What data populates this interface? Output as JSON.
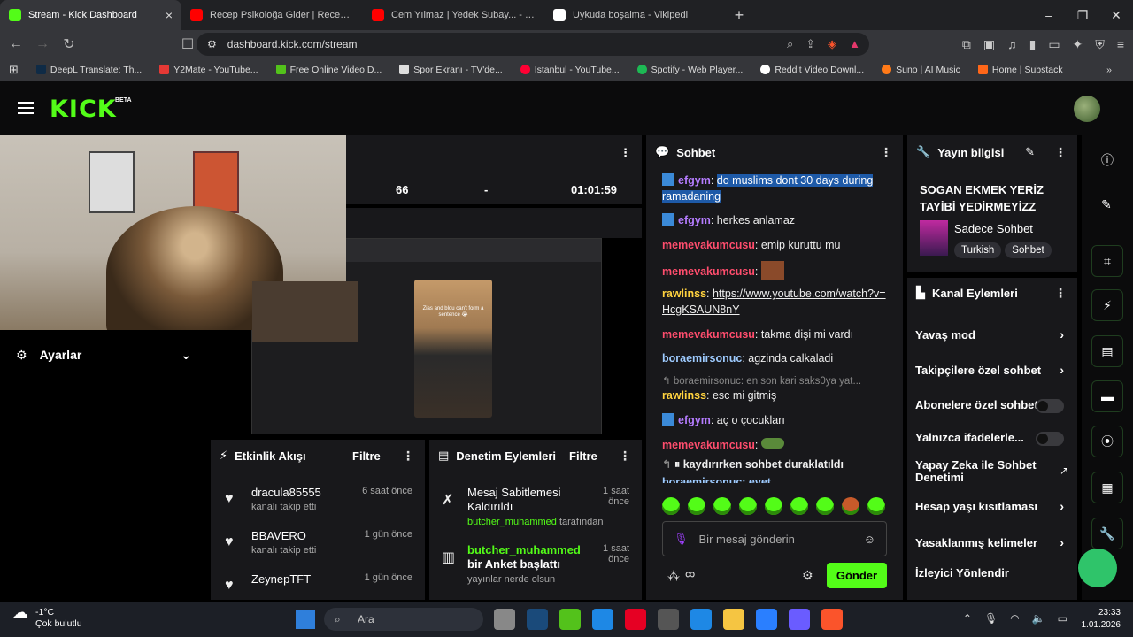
{
  "browser": {
    "tabs": [
      {
        "title": "Stream - Kick Dashboard",
        "color": "#53fc18",
        "active": true
      },
      {
        "title": "Recep Psikoloğa Gider | Recep İvedik",
        "color": "#ff0000"
      },
      {
        "title": "Cem Yılmaz | Yedek Subay... - You",
        "color": "#ff0000"
      },
      {
        "title": "Uykuda boşalma - Vikipedi",
        "color": "#ffffff"
      }
    ],
    "new_tab": "+",
    "url": "dashboard.kick.com/stream",
    "bookmarks": [
      {
        "label": "DeepL Translate: Th...",
        "color": "#0f2b46"
      },
      {
        "label": "Y2Mate - YouTube...",
        "color": "#e53935"
      },
      {
        "label": "Free Online Video D...",
        "color": "#53c21b"
      },
      {
        "label": "Spor Ekranı - TV'de...",
        "color": "#dddddd"
      },
      {
        "label": "Istanbul - YouTube...",
        "color": "#ff0033"
      },
      {
        "label": "Spotify - Web Player...",
        "color": "#1db954"
      },
      {
        "label": "Reddit Video Downl...",
        "color": "#ffffff"
      },
      {
        "label": "Suno | AI Music",
        "color": "#ff7a18"
      },
      {
        "label": "Home | Substack",
        "color": "#ff6719"
      }
    ]
  },
  "kick": {
    "logo": "KICK",
    "beta": "BETA"
  },
  "stats": {
    "viewers": "66",
    "dash": "-",
    "duration": "01:01:59"
  },
  "preview": {
    "caption": "Zias and blou can't form a sentence 😭"
  },
  "settings": {
    "label": "Ayarlar"
  },
  "activity": {
    "title": "Etkinlik Akışı",
    "filter": "Filtre",
    "items": [
      {
        "name": "dracula85555",
        "sub": "kanalı takip etti",
        "time": "6 saat önce"
      },
      {
        "name": "BBAVERO",
        "sub": "kanalı takip etti",
        "time": "1 gün önce"
      },
      {
        "name": "ZeynepTFT",
        "sub": "kanalı takip etti",
        "time": "1 gün önce"
      }
    ]
  },
  "moderation": {
    "title": "Denetim Eylemleri",
    "filter": "Filtre",
    "items": [
      {
        "title": "Mesaj Sabitlemesi Kaldırıldı",
        "user": "butcher_muhammed",
        "suffix": "tarafından",
        "time": "1 saat önce"
      },
      {
        "title": "butcher_muhammed",
        "title2": "bir Anket başlattı",
        "sub": "yayınlar nerde olsun",
        "time": "1 saat önce"
      }
    ]
  },
  "chat": {
    "title": "Sohbet",
    "messages": [
      {
        "user": "efgym",
        "color": "#b57cff",
        "badge": true,
        "text": "do muslims dont 30 days during ramadaning",
        "highlight": true
      },
      {
        "user": "efgym",
        "color": "#b57cff",
        "badge": true,
        "text": "herkes anlamaz"
      },
      {
        "user": "memevakumcusu",
        "color": "#ff4d6d",
        "text": "emip kuruttu mu"
      },
      {
        "user": "memevakumcusu",
        "color": "#ff4d6d",
        "text": ""
      },
      {
        "user": "rawlinss",
        "color": "#ffd23f",
        "text": "https://www.youtube.com/watch?v=HcgKSAUN8nY",
        "link": true
      },
      {
        "user": "memevakumcusu",
        "color": "#ff4d6d",
        "text": "takma dişi mi vardı"
      },
      {
        "user": "boraemirsonuc",
        "color": "#9ecbff",
        "text": "agzinda calkaladi"
      },
      {
        "user": "rawlinss",
        "color": "#ffd23f",
        "text": "esc mi gitmiş",
        "reply": "boraemirsonuc: en son kari saks0ya yat..."
      },
      {
        "user": "efgym",
        "color": "#b57cff",
        "badge": true,
        "text": "aç o çocukları"
      },
      {
        "user": "memevakumcusu",
        "color": "#ff4d6d",
        "text": ""
      }
    ],
    "paused": "kaydırırken sohbet duraklatıldı",
    "partial": "boraemirsonuc: evet",
    "placeholder": "Bir mesaj gönderin",
    "send": "Gönder"
  },
  "stream_info": {
    "title": "Yayın bilgisi",
    "stream_title": "SOGAN EKMEK YERİZ TAYİBİ YEDİRMEYİZZ",
    "category": "Sadece Sohbet",
    "tags": [
      "Turkish",
      "Sohbet"
    ]
  },
  "channel_actions": {
    "title": "Kanal Eylemleri",
    "items": [
      {
        "label": "Yavaş mod",
        "type": "arrow"
      },
      {
        "label": "Takipçilere özel sohbet",
        "type": "arrow"
      },
      {
        "label": "Abonelere özel sohbet",
        "type": "toggle"
      },
      {
        "label": "Yalnızca ifadelerle...",
        "type": "toggle"
      },
      {
        "label": "Yapay Zeka ile Sohbet Denetimi",
        "type": "external"
      },
      {
        "label": "Hesap yaşı kısıtlaması",
        "type": "arrow"
      },
      {
        "label": "Yasaklanmış kelimeler",
        "type": "arrow"
      },
      {
        "label": "İzleyici Yönlendir",
        "type": "none"
      }
    ]
  },
  "taskbar": {
    "temp": "-1°C",
    "weather": "Çok bulutlu",
    "search": "Ara",
    "time": "23:33",
    "date": "1.01.2026"
  }
}
